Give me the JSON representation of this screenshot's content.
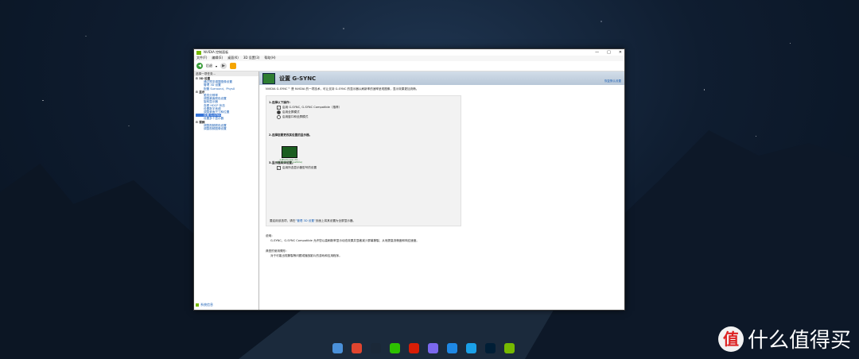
{
  "window": {
    "title": "NVIDIA 控制面板",
    "controls": [
      "—",
      "□",
      "✕"
    ]
  },
  "menubar": [
    "文件(F)",
    "编辑(E)",
    "桌面(K)",
    "3D 设置(3)",
    "帮助(H)"
  ],
  "toolbar": {
    "back_label": "后退",
    "dropdown": "▾"
  },
  "left": {
    "header": "选择一项任务...",
    "tree": [
      {
        "type": "cat",
        "label": "⊟ 3D 设置"
      },
      {
        "type": "leaf",
        "label": "通过预览调整图像设置"
      },
      {
        "type": "leaf",
        "label": "管理 3D 设置"
      },
      {
        "type": "leaf",
        "label": "配置 Surround、PhysX"
      },
      {
        "type": "cat",
        "label": "⊟ 显示"
      },
      {
        "type": "leaf",
        "label": "更改分辨率"
      },
      {
        "type": "leaf",
        "label": "调整桌面颜色设置"
      },
      {
        "type": "leaf",
        "label": "旋转显示器"
      },
      {
        "type": "leaf",
        "label": "查看 HDCP 状态"
      },
      {
        "type": "leaf",
        "label": "设置数字音频"
      },
      {
        "type": "leaf",
        "label": "调整桌面尺寸和位置"
      },
      {
        "type": "leaf",
        "label": "设置 G-SYNC",
        "selected": true
      },
      {
        "type": "leaf",
        "label": "设置多个显示器"
      },
      {
        "type": "cat",
        "label": "⊟ 视频"
      },
      {
        "type": "leaf",
        "label": "调整视频颜色设置"
      },
      {
        "type": "leaf",
        "label": "调整视频图像设置"
      }
    ],
    "footer_link": "系统信息"
  },
  "right": {
    "title": "设置 G-SYNC",
    "restore": "恢复默认设置",
    "description": "NVIDIA G-SYNC™ 是 NVIDIA 的一项技术，可让支持 G-SYNC 的显示器以刷新率的速率呈现图像，显示效果更加流畅。",
    "step1": "1.选择以下操作：",
    "enable_gsync": "启用 G-SYNC, G-SYNC Compatible（推荐）",
    "fullscreen": "启用全屏模式",
    "windowed_fullscreen": "启用窗口和全屏模式",
    "step2": "2.选择您要更改其设置的显示器。",
    "monitor_name": "1.Blackview 24...",
    "monitor_tag": "(G-SYNC Compatible)",
    "step3": "3.显示器具体设置。",
    "specific_setting": "启用所选显示器型号的设置",
    "bottom_note_pre": "要启用该选项，请在",
    "bottom_note_link": "“管理 3D 设置”",
    "bottom_note_post": "页面上将其设置为全屏显示器。",
    "desc_heading": "说明：",
    "desc_text": "G-SYNC、G-SYNC Compatible 允许您以高刷新率显示动态效果并显著减少屏幕撕裂，从而提高流畅度和响应速度。",
    "usage_heading": "典型的使用情形：",
    "usage_text": "对于可能出现撕裂等问题或播放影片的游戏和应用程序。"
  },
  "taskbar": [
    {
      "icon": "file-manager-icon",
      "color": "#4a90d9"
    },
    {
      "icon": "chrome-icon",
      "color": "#e0452f"
    },
    {
      "icon": "steam-icon",
      "color": "#1b2838"
    },
    {
      "icon": "wechat-icon",
      "color": "#2dc100"
    },
    {
      "icon": "netease-music-icon",
      "color": "#d81e06"
    },
    {
      "icon": "wps-icon",
      "color": "#7b68ee"
    },
    {
      "icon": "app-star-icon",
      "color": "#1e88e5"
    },
    {
      "icon": "qq-icon",
      "color": "#1aa0e8"
    },
    {
      "icon": "photoshop-icon",
      "color": "#001e36"
    },
    {
      "icon": "nvidia-icon",
      "color": "#76b900"
    }
  ],
  "watermark": {
    "badge": "值",
    "text": "什么值得买"
  }
}
